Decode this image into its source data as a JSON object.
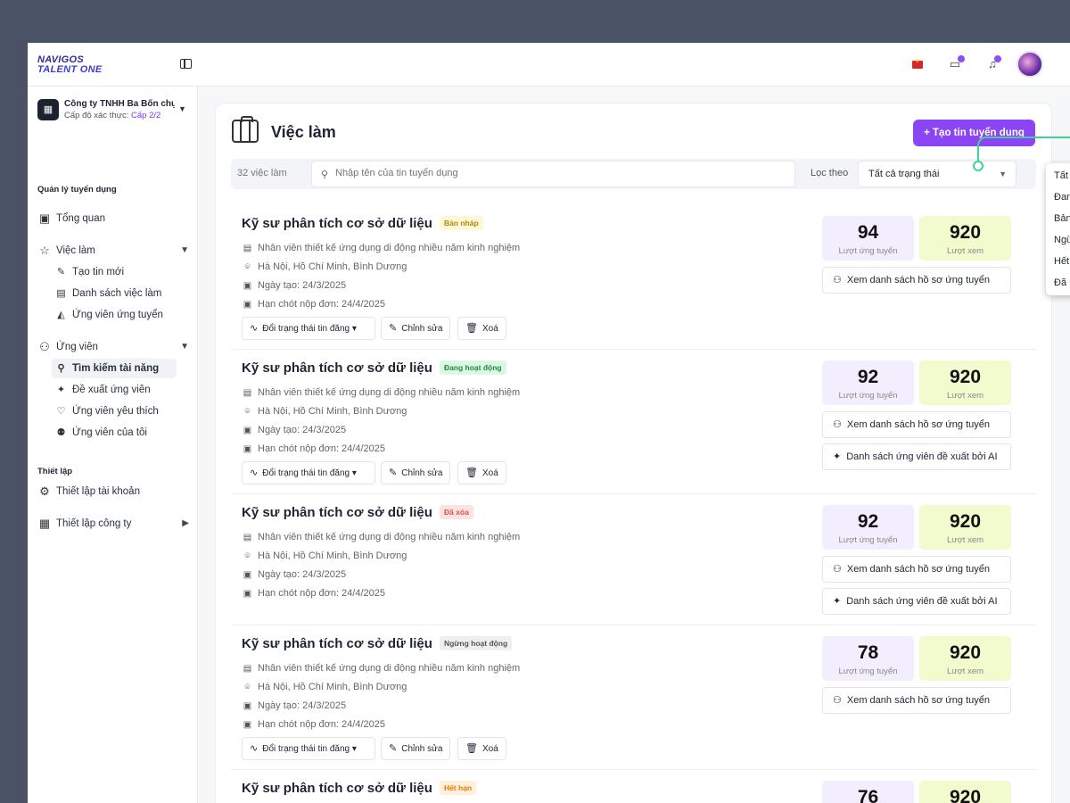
{
  "brand": {
    "line1": "NAVIGOS",
    "line2": "TALENT ONE"
  },
  "company": {
    "name": "Công ty TNHH Ba Bốn chụ...",
    "level_prefix": "Cấp độ xác thực: ",
    "level_value": "Cấp 2/2"
  },
  "sidebar": {
    "section1": "Quản lý tuyển dụng",
    "overview": "Tổng quan",
    "jobs": "Việc làm",
    "jobs_sub": [
      "Tạo tin mới",
      "Danh sách việc làm",
      "Ứng viên ứng tuyển"
    ],
    "candidates": "Ứng viên",
    "candidates_sub": [
      "Tìm kiếm tài năng",
      "Đề xuất ứng viên",
      "Ứng viên yêu thích",
      "Ứng viên của tôi"
    ],
    "section2": "Thiết lập",
    "account_settings": "Thiết lập tài khoản",
    "company_settings": "Thiết lập công ty"
  },
  "page": {
    "title": "Việc làm",
    "create_button": "Tạo tin tuyển dụng",
    "count": "32 việc làm",
    "search_placeholder": "Nhập tên của tin tuyển dụng",
    "filter_label": "Lọc theo",
    "filter_value": "Tất cả trạng thái"
  },
  "labels": {
    "applied": "Lượt ứng tuyển",
    "views": "Lượt xem",
    "change_status": "Đổi trạng thái tin đăng",
    "edit": "Chỉnh sửa",
    "delete": "Xoá",
    "view_profiles": "Xem danh sách hồ sơ ứng tuyển",
    "ai_list": "Danh sách ứng viên đề xuất bởi AI"
  },
  "jobs": [
    {
      "title": "Kỹ sư phân tích cơ sở dữ liệu",
      "status": "Bản nháp",
      "desc": "Nhân viên thiết kế ứng dụng di động nhiều năm kinh nghiệm",
      "location": "Hà Nội, Hồ Chí Minh, Bình Dương",
      "created": "Ngày tạo: 24/3/2025",
      "deadline": "Hạn chót nộp đơn: 24/4/2025",
      "applied": "94",
      "views": "920"
    },
    {
      "title": "Kỹ sư phân tích cơ sở dữ liệu",
      "status": "Đang hoạt động",
      "desc": "Nhân viên thiết kế ứng dụng di động nhiều năm kinh nghiệm",
      "location": "Hà Nội, Hồ Chí Minh, Bình Dương",
      "created": "Ngày tạo: 24/3/2025",
      "deadline": "Hạn chót nộp đơn: 24/4/2025",
      "applied": "92",
      "views": "920"
    },
    {
      "title": "Kỹ sư phân tích cơ sở dữ liệu",
      "status": "Đã xóa",
      "desc": "Nhân viên thiết kế ứng dụng di động nhiều năm kinh nghiệm",
      "location": "Hà Nội, Hồ Chí Minh, Bình Dương",
      "created": "Ngày tạo: 24/3/2025",
      "deadline": "Hạn chót nộp đơn: 24/4/2025",
      "applied": "92",
      "views": "920"
    },
    {
      "title": "Kỹ sư phân tích cơ sở dữ liệu",
      "status": "Ngừng hoạt động",
      "desc": "Nhân viên thiết kế ứng dụng di động nhiều năm kinh nghiệm",
      "location": "Hà Nội, Hồ Chí Minh, Bình Dương",
      "created": "Ngày tạo: 24/3/2025",
      "deadline": "Hạn chót nộp đơn: 24/4/2025",
      "applied": "78",
      "views": "920"
    },
    {
      "title": "Kỹ sư phân tích cơ sở dữ liệu",
      "status": "Hết hạn",
      "applied": "76",
      "views": "920"
    }
  ],
  "dropdown_options": [
    "Tất",
    "Đan",
    "Bản",
    "Ngừ",
    "Hết",
    "Đã"
  ],
  "colors": {
    "accent": "#8b45f5",
    "connector": "#3fd39a"
  }
}
